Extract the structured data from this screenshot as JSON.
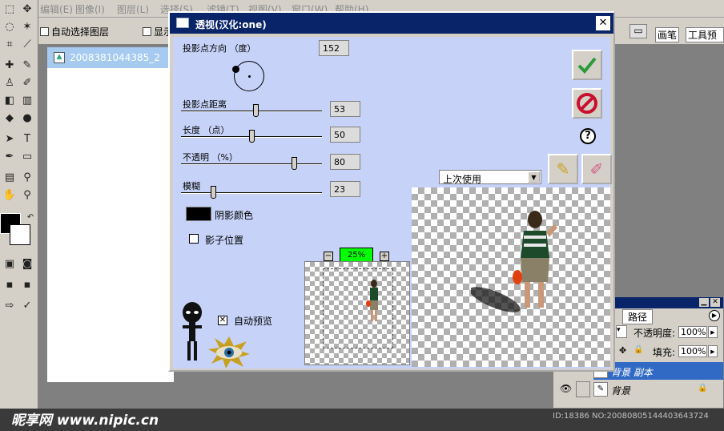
{
  "app": {
    "menu": [
      "编辑(E)",
      "图像(I)",
      "图层(L)",
      "选择(S)",
      "滤镜(T)",
      "视图(V)",
      "窗口(W)",
      "帮助(H)"
    ],
    "options": {
      "auto_select_layer": "自动选择图层",
      "show_partial": "显示"
    },
    "palette_tabs": [
      "画笔",
      "工具预"
    ],
    "document_title": "2008381044385_2"
  },
  "dialog": {
    "title": "透视(汉化:one)",
    "direction": {
      "label": "投影点方向 （度）",
      "value": "152"
    },
    "distance": {
      "label": "投影点距离",
      "value": "53",
      "level": 0.53
    },
    "length": {
      "label": "长度 （点）",
      "value": "50",
      "level": 0.5
    },
    "opacity": {
      "label": "不透明 （%）",
      "value": "80",
      "level": 0.8
    },
    "blur": {
      "label": "模糊",
      "value": "23",
      "level": 0.23
    },
    "shadow_color": {
      "label": "阴影颜色",
      "color": "#000000"
    },
    "shadow_position": {
      "label": "影子位置",
      "checked": false
    },
    "auto_preview": {
      "label": "自动预览",
      "checked": true
    },
    "zoom": {
      "value": "25%"
    },
    "preset": {
      "selected": "上次使用"
    },
    "help_label": "?"
  },
  "layers": {
    "tab": "路径",
    "opacity": {
      "label": "不透明度:",
      "value": "100%"
    },
    "fill": {
      "label": "填充:",
      "value": "100%"
    },
    "items": [
      {
        "name": "背景 副本",
        "selected": true
      },
      {
        "name": "背景",
        "selected": false
      }
    ]
  },
  "footer": {
    "watermark": "昵享网 www.nipic.cn",
    "image_id": "ID:18386 NO:20080805144403643724"
  },
  "colors": {
    "accent_title": "#0a246a",
    "dialog_body": "#c6d2f8",
    "ok_green": "#2a9a3a",
    "cancel_red": "#c8102e",
    "zoom_box": "#00ff00"
  }
}
